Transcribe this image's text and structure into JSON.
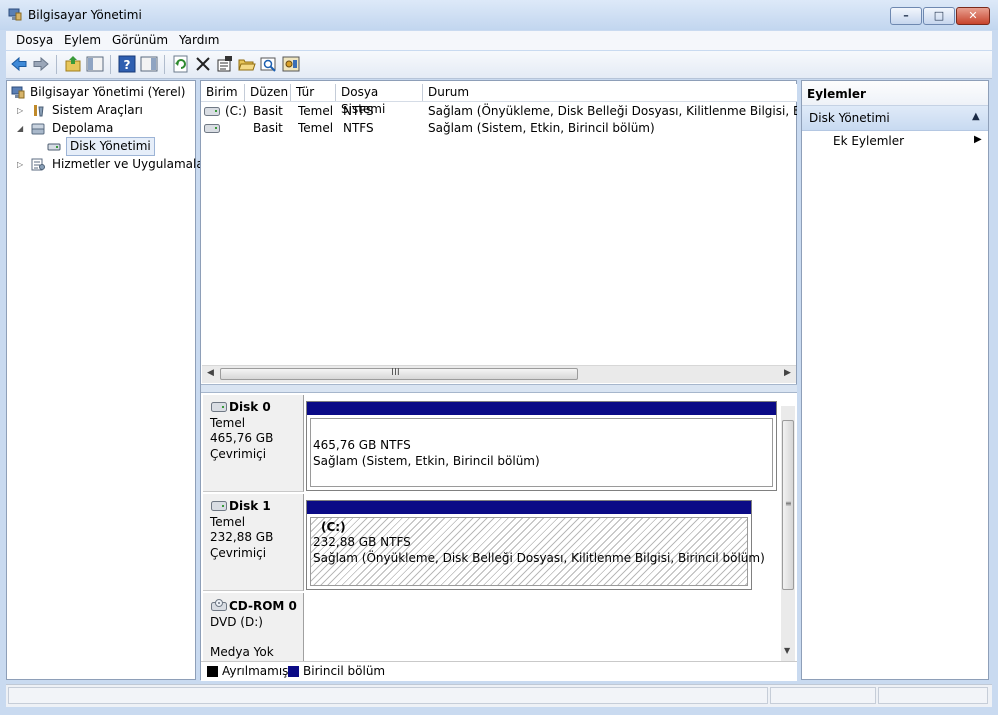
{
  "window": {
    "title": "Bilgisayar Yönetimi"
  },
  "menu": [
    "Dosya",
    "Eylem",
    "Görünüm",
    "Yardım"
  ],
  "toolbar": [
    "back-arrow-icon",
    "forward-arrow-icon",
    "up-folder-icon",
    "show-hide-tree-icon",
    "help-icon",
    "show-hide-action-pane-icon",
    "refresh-icon",
    "delete-icon",
    "properties-icon",
    "open-folder-icon",
    "search-disk-icon",
    "settings-icon"
  ],
  "tree": {
    "root": "Bilgisayar Yönetimi (Yerel)",
    "system_tools": "Sistem Araçları",
    "storage": "Depolama",
    "disk_management": "Disk Yönetimi",
    "services": "Hizmetler ve Uygulamalar"
  },
  "volume_list": {
    "columns": [
      "Birim",
      "Düzen",
      "Tür",
      "Dosya Sistemi",
      "Durum"
    ],
    "rows": [
      {
        "volume": "(C:)",
        "layout": "Basit",
        "type": "Temel",
        "fs": "NTFS",
        "status": "Sağlam (Önyükleme, Disk Belleği Dosyası, Kilitlenme Bilgisi, Birincil bölüm)"
      },
      {
        "volume": "",
        "layout": "Basit",
        "type": "Temel",
        "fs": "NTFS",
        "status": "Sağlam (Sistem, Etkin, Birincil bölüm)"
      }
    ],
    "scroll_grip": "III"
  },
  "disks": [
    {
      "name": "Disk 0",
      "type": "Temel",
      "size": "465,76 GB",
      "state": "Çevrimiçi",
      "volume": {
        "label": "",
        "size_fs": "465,76 GB NTFS",
        "status": "Sağlam (Sistem, Etkin, Birincil bölüm)"
      }
    },
    {
      "name": "Disk 1",
      "type": "Temel",
      "size": "232,88 GB",
      "state": "Çevrimiçi",
      "volume": {
        "label": "(C:)",
        "size_fs": "232,88 GB NTFS",
        "status": "Sağlam (Önyükleme, Disk Belleği Dosyası, Kilitlenme Bilgisi, Birincil bölüm)"
      }
    },
    {
      "name": "CD-ROM 0",
      "type": "DVD (D:)",
      "size": "",
      "state": "Medya Yok"
    }
  ],
  "legend": [
    {
      "label": "Ayrılmamış",
      "color": "#000000"
    },
    {
      "label": "Birincil bölüm",
      "color": "#0a0a86"
    }
  ],
  "actions": {
    "title": "Eylemler",
    "section": "Disk Yönetimi",
    "item": "Ek Eylemler"
  },
  "colors": {
    "primary_partition": "#0a0a86",
    "selection": "#e6eef9"
  }
}
